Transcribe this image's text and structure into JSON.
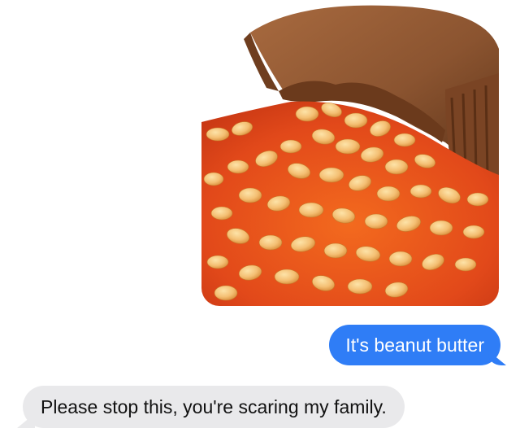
{
  "conversation": {
    "image_message": {
      "alt": "Reese's cup filled with baked beans"
    },
    "sent_message": {
      "text": "It's beanut butter"
    },
    "received_message": {
      "text": "Please stop this, you're scaring my family."
    }
  },
  "colors": {
    "sent_bubble": "#2f7df6",
    "received_bubble": "#e9e9eb",
    "bean": "#f3c07a",
    "sauce": "#e8541c",
    "chocolate": "#8b5430"
  }
}
